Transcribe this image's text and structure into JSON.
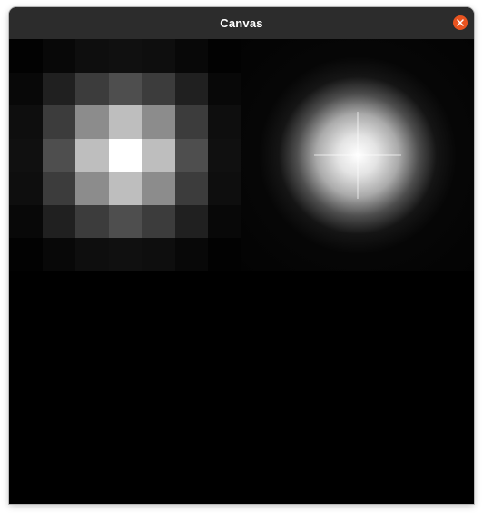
{
  "window": {
    "title": "Canvas"
  },
  "icons": {
    "close": "close-icon"
  },
  "colors": {
    "titlebar": "#2c2c2c",
    "close_button": "#e95420",
    "canvas_background": "#000000"
  },
  "canvas": {
    "pixel_grid": [
      [
        2,
        8,
        14,
        16,
        14,
        8,
        2
      ],
      [
        8,
        32,
        60,
        78,
        60,
        32,
        8
      ],
      [
        14,
        60,
        140,
        190,
        140,
        60,
        14
      ],
      [
        16,
        78,
        190,
        255,
        190,
        78,
        16
      ],
      [
        14,
        60,
        140,
        190,
        140,
        60,
        14
      ],
      [
        8,
        32,
        60,
        78,
        60,
        32,
        8
      ],
      [
        2,
        8,
        14,
        16,
        14,
        8,
        2
      ]
    ]
  }
}
